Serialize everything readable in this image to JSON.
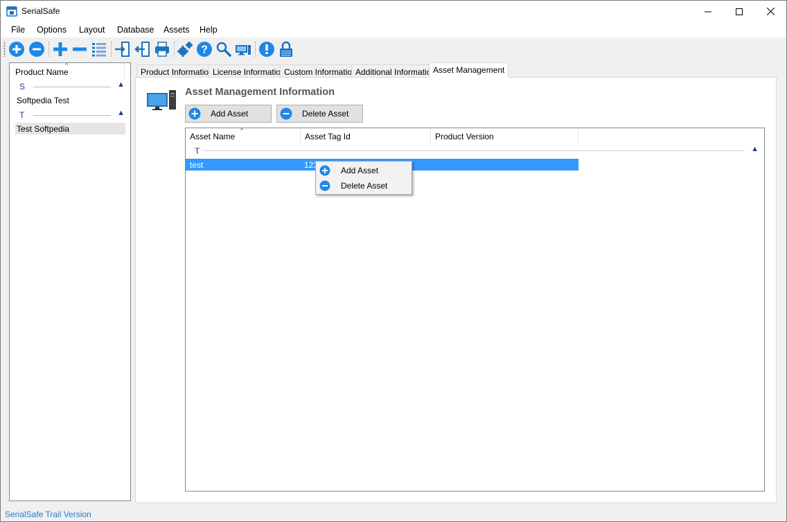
{
  "window": {
    "title": "SerialSafe"
  },
  "menu": [
    "File",
    "Options",
    "Layout",
    "Database",
    "Assets",
    "Help"
  ],
  "toolbar_icons": [
    "add-circle-icon",
    "remove-circle-icon",
    "plus-icon",
    "minus-icon",
    "list-icon",
    "import-icon",
    "export-icon",
    "print-icon",
    "settings-gears-icon",
    "help-icon",
    "search-icon",
    "computer-icon",
    "alert-icon",
    "lock-icon"
  ],
  "left_panel": {
    "column_header": "Product Name",
    "groups": [
      {
        "letter": "S",
        "items": [
          "Softpedia Test"
        ]
      },
      {
        "letter": "T",
        "items": [
          "Test Softpedia"
        ]
      }
    ]
  },
  "tabs": [
    "Product Information",
    "License Information",
    "Custom Information",
    "Additional Information",
    "Asset Management"
  ],
  "active_tab": "Asset Management",
  "asset_panel": {
    "title": "Asset Management Information",
    "add_button": "Add Asset",
    "delete_button": "Delete Asset",
    "columns": [
      "Asset Name",
      "Asset Tag Id",
      "Product Version"
    ],
    "group_letter": "T",
    "rows": [
      {
        "name": "test",
        "tag": "123",
        "version": ""
      }
    ]
  },
  "context_menu": [
    "Add Asset",
    "Delete Asset"
  ],
  "status": "SerialSafe Trail Version",
  "colors": {
    "accent": "#1e88e5",
    "selection": "#3399ff",
    "group_text": "#1a3e8a",
    "status_text": "#2b78c8"
  }
}
